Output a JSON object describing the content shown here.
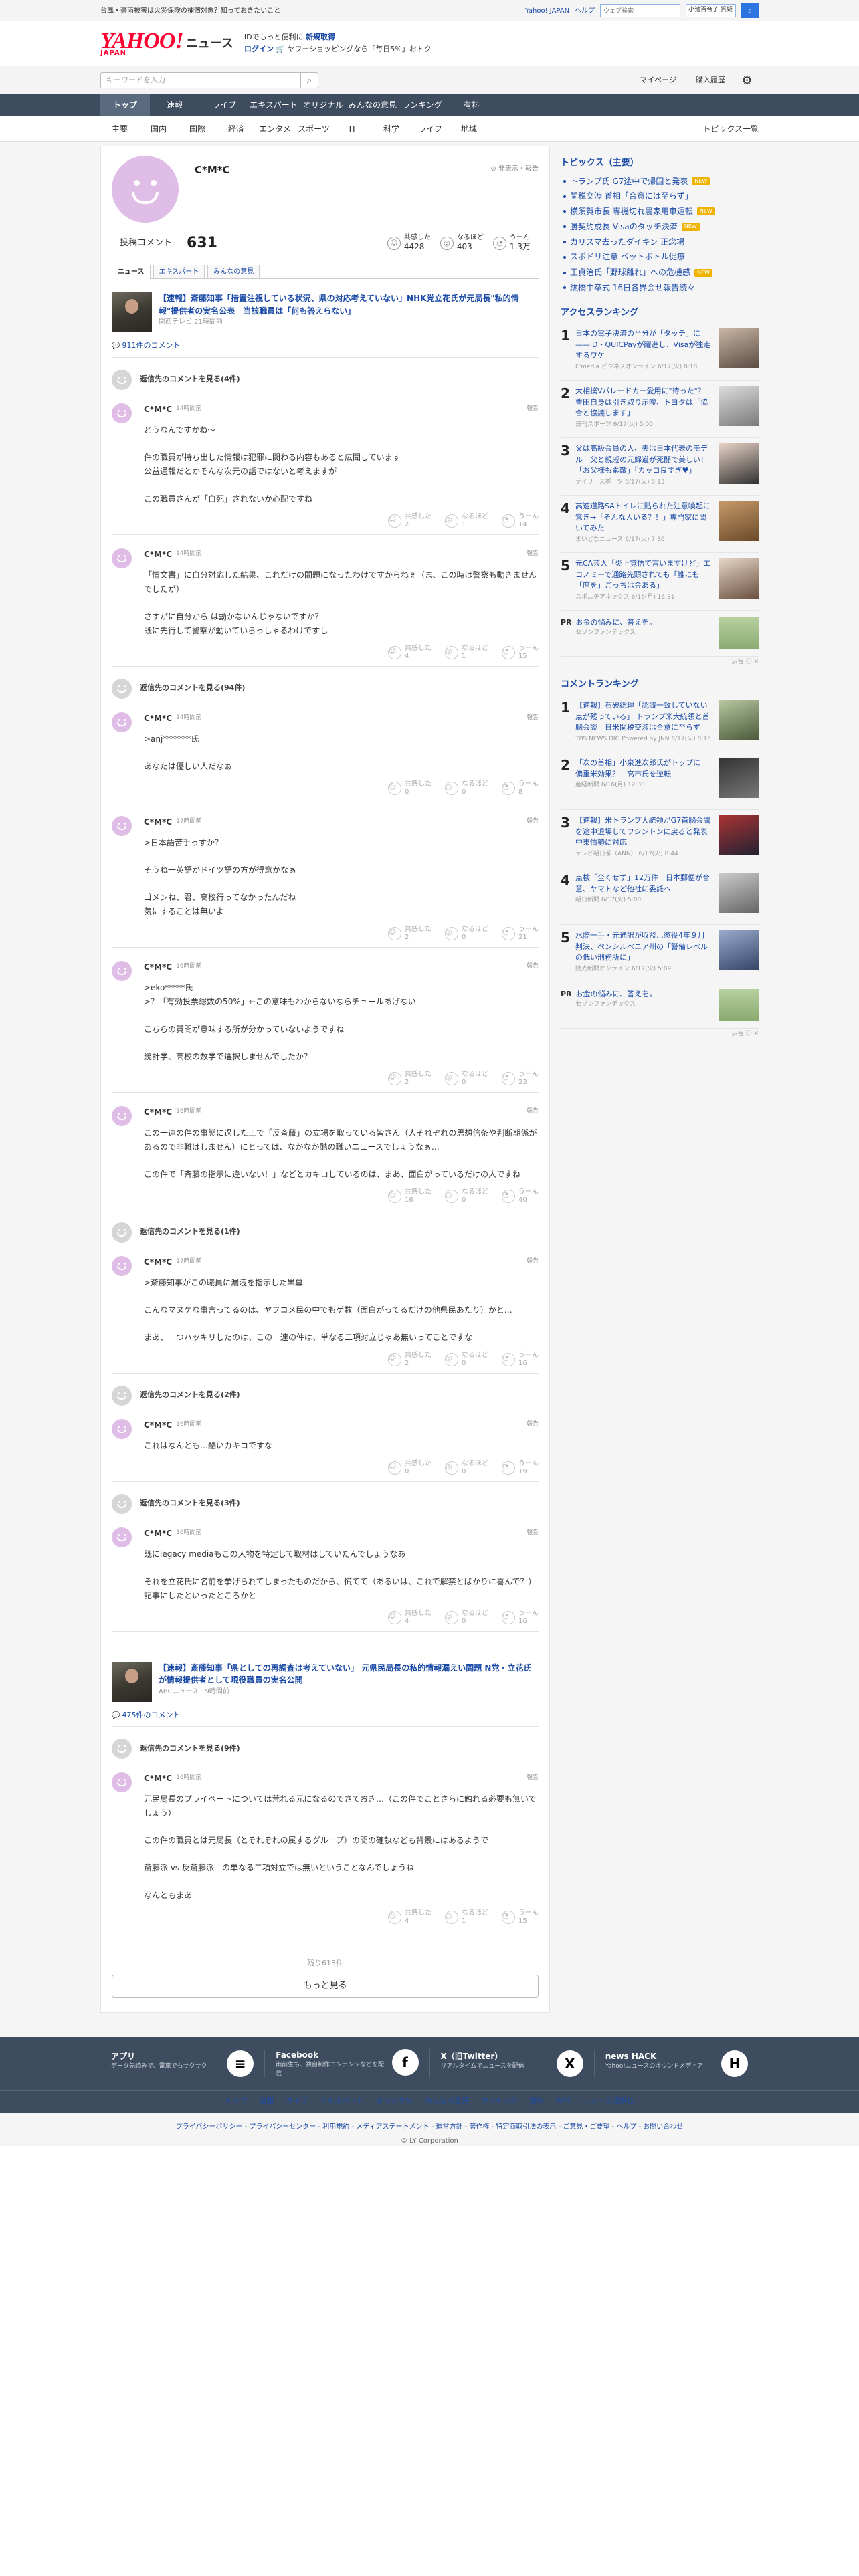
{
  "promo": {
    "text": "台風・豪雨被害は火災保険の補償対象？知っておきたいこと",
    "yahoo_japan": "Yahoo! JAPAN",
    "help": "ヘルプ",
    "web_search_placeholder": "ウェブ検索",
    "search_keyword": "小池百合子 質疑"
  },
  "header": {
    "logo": "YAHOO!",
    "logo_sub_jp": "JAPAN",
    "section": "ニュース",
    "msg1_prefix": "IDでもっと便利に",
    "msg1_link": "新規取得",
    "login": "ログイン",
    "msg2": "ヤフーショッピングなら「毎日5%」おトク"
  },
  "searchbar": {
    "placeholder": "キーワードを入力",
    "mypage": "マイページ",
    "history": "購入履歴"
  },
  "nav": [
    "トップ",
    "速報",
    "ライブ",
    "エキスパート",
    "オリジナル",
    "みんなの意見",
    "ランキング",
    "有料"
  ],
  "subnav": [
    "主要",
    "国内",
    "国際",
    "経済",
    "エンタメ",
    "スポーツ",
    "IT",
    "科学",
    "ライフ",
    "地域"
  ],
  "topics_all": "トピックス一覧",
  "profile": {
    "name": "C*M*C",
    "hide": "非表示・報告",
    "posts_label": "投稿コメント",
    "posts": "631",
    "agree_label": "共感した",
    "agree": "4428",
    "naruhodo_label": "なるほど",
    "naruhodo": "403",
    "hmm_label": "うーん",
    "hmm": "1.3万",
    "tabs": [
      "ニュース",
      "エキスパート",
      "みんなの意見"
    ]
  },
  "article1": {
    "title": "【速報】斎藤知事「措置注視している状況、県の対応考えていない」NHK党立花氏が元局長\"私的情報\"提供者の実名公表　当該職員は「何も答えらない」",
    "source": "関西テレビ 21時間前",
    "count": "911件のコメント"
  },
  "article2": {
    "title": "【速報】斎藤知事「県としての再調査は考えていない」 元県民局長の私的情報漏えい問題 N党・立花氏が情報提供者として現役職員の実名公開",
    "source": "ABCニュース 19時間前",
    "count": "475件のコメント"
  },
  "labels": {
    "report": "報告",
    "agree": "共感した",
    "naruhodo": "なるほど",
    "hmm": "うーん"
  },
  "threads": [
    {
      "reply": "返信先のコメントを見る(4件)",
      "time": "14時間前",
      "paras": [
        "どうなんですかね〜",
        "件の職員が持ち出した情報は犯罪に関わる内容もあると広聞しています\n公益通報だとかそんな次元の話ではないと考えますが",
        "この職員さんが「自死」されないか心配ですね"
      ],
      "a": "2",
      "n": "1",
      "h": "14"
    },
    {
      "reply": "",
      "time": "14時間前",
      "paras": [
        "「情文書」に自分対応した結果、これだけの問題になったわけですからねぇ（ま、この時は警察も動きませんでしたが）",
        "さすがに自分から は動かないんじゃないですか？\n既に先行して警察が動いていらっしゃるわけですし"
      ],
      "a": "4",
      "n": "1",
      "h": "15"
    },
    {
      "reply": "返信先のコメントを見る(94件)",
      "time": "14時間前",
      "paras": [
        ">anj*******氏",
        "あなたは優しい人だなぁ"
      ],
      "a": "0",
      "n": "0",
      "h": "8"
    },
    {
      "reply": "",
      "time": "17時間前",
      "paras": [
        ">日本語苦手っすか？",
        "そうね一英語かドイツ語の方が得意かなぁ",
        "ゴメンね、君、高校行ってなかったんだね\n気にすることは無いよ"
      ],
      "a": "2",
      "n": "0",
      "h": "21"
    },
    {
      "reply": "",
      "time": "16時間前",
      "paras": [
        ">eko*****氏\n>？「有効投票総数の50%」←この意味もわからないならチュールあげない",
        "こちらの質問が意味する所が分かっていないようですね",
        "統計学、高校の数学で選択しませんでしたか？"
      ],
      "a": "2",
      "n": "0",
      "h": "23"
    },
    {
      "reply": "",
      "time": "16時間前",
      "paras": [
        "この一連の件の事態に過した上で「反斉藤」の立場を取っている皆さん（人それぞれの思想信条や判断期係があるので非難はしません）にとっては、なかなか酷の職いニュースでしょうなぁ…",
        "この件で「斉藤の指示に違いない！」などとカキコしているのは、まあ、面白がっているだけの人ですね"
      ],
      "a": "16",
      "n": "0",
      "h": "40"
    },
    {
      "reply": "返信先のコメントを見る(1件)",
      "time": "17時間前",
      "paras": [
        ">斎藤知事がこの職員に漏洩を指示した黒幕",
        "こんなマヌケな事言ってるのは、ヤフコメ民の中でもゲ数（面白がってるだけの他県民あたり）かと…",
        "まあ、一つハッキリしたのは、この一連の件は、単なる二項対立じゃあ無いってことですな"
      ],
      "a": "2",
      "n": "0",
      "h": "16"
    },
    {
      "reply": "返信先のコメントを見る(2件)",
      "time": "16時間前",
      "paras": [
        "これはなんとも…酷いカキコですな"
      ],
      "a": "0",
      "n": "0",
      "h": "19"
    },
    {
      "reply": "返信先のコメントを見る(3件)",
      "time": "16時間前",
      "paras": [
        "既にlegacy mediaもこの人物を特定して取材はしていたんでしょうなあ",
        "それを立花氏に名前を挙げられてしまったものだから、慌てて（あるいは、これで解禁とばかりに喜んで？）記事にしたといったところかと"
      ],
      "a": "4",
      "n": "0",
      "h": "16"
    }
  ],
  "thread2": {
    "reply": "返信先のコメントを見る(9件)",
    "time": "16時間前",
    "paras": [
      "元民局長のプライベートについては荒れる元になるのでさておき…（この件でことさらに触れる必要も無いでしょう）",
      "この件の職員とは元局長（とそれぞれの属するグループ）の間の確執なども背景にはあるようで",
      "斎藤派 vs 反斎藤派　の単なる二項対立では無いということなんでしょうね",
      "なんともまあ"
    ],
    "a": "4",
    "n": "1",
    "h": "15"
  },
  "remain": "残り613件",
  "more": "もっと見る",
  "side": {
    "topics_head": "トピックス（主要）",
    "topics": [
      {
        "t": "トランプ氏 G7途中で帰国と発表",
        "new": "NEW"
      },
      {
        "t": "関税交渉 首相「合意には至らず」",
        "new": ""
      },
      {
        "t": "横須賀市長 専機切れ農家用車運転",
        "new": "NEW"
      },
      {
        "t": "勝契約成長 Visaのタッチ決済",
        "new": "NEW"
      },
      {
        "t": "カリスマ去ったダイキン 正念場",
        "new": ""
      },
      {
        "t": "スポドリ注意 ペットボトル促療",
        "new": ""
      },
      {
        "t": "王貞治氏「野球離れ」への危機感",
        "new": "NEW"
      },
      {
        "t": "紘橋中卒式 16日各界会せ報告続々",
        "new": ""
      }
    ],
    "access_head": "アクセスランキング",
    "access": [
      {
        "t": "日本の電子決済の半分が「タッチ」に——iD・QUICPayが躍進し、Visaが独走するワケ",
        "m": "ITmedia ビジネスオンライン 6/17(火) 8:18"
      },
      {
        "t": "大相撲Vパレードカー愛用に\"待った\"？曹田自身は引き取り示唆、トヨタは「協合と協議します」",
        "m": "日刊スポーツ 6/17(火) 5:00"
      },
      {
        "t": "父は高級会員の人、夫は日本代表のモデル　父と親戚の元歸道が死闘で美しい！「お父様も素敵」「カッコ良すぎ♥」",
        "m": "デイリースポーツ 6/17(火) 6:13"
      },
      {
        "t": "高速道路SAトイレに貼られた注意喚起に驚き→「そんな人いる？！」専門家に聞いてみた",
        "m": "まいどなニュース 6/17(火) 7:30"
      },
      {
        "t": "元CA芸人「炎上覚悟で言いますけど」エコノミーで通路先頭されても「誰にも「席を」ごっちは金ある」",
        "m": "スポニチアネックス 6/16(月) 16:31"
      }
    ],
    "ad1": {
      "title": "お金の悩みに、答えを。",
      "sub": "セゾンファンデックス"
    },
    "comment_head": "コメントランキング",
    "comment": [
      {
        "t": "【速報】石破総理「認識一致していない点が残っている」 トランプ米大統領と首脳会談　日米関税交渉は合意に至らず",
        "m": "TBS NEWS DIG Powered by JNN 6/17(火) 8:15"
      },
      {
        "t": "「次の首相」小泉進次郎氏がトップに　偏重米効果？　高市氏を逆転",
        "m": "産経新聞 6/16(月) 12:30"
      },
      {
        "t": "【速報】米トランプ大統領がG7首脳会議を途中退場してワシントンに戻ると発表　中東情勢に対応",
        "m": "テレビ朝日系（ANN） 6/17(火) 8:44"
      },
      {
        "t": "点検「全くせず」12万件　日本郵便が合意、ヤマトなど他社に委託へ",
        "m": "朝日新聞 6/17(火) 5:00"
      },
      {
        "t": "水際一手・元通訳が収監…懲役4年９月判決、ペンシルベニア州の「警備レベルの低い刑務所に」",
        "m": "読売新聞オンライン 6/17(火) 5:09"
      }
    ],
    "ad2": {
      "title": "お金の悩みに、答えを。",
      "sub": "セゾンファンデックス"
    },
    "ad_label": "広告"
  },
  "footer": {
    "apps": [
      {
        "title": "アプリ",
        "sub": "データ先読みで、電車でもサクサク",
        "icon": "≡"
      },
      {
        "title": "Facebook",
        "sub": "雨前生も、独自制作コンテンツなどを配信",
        "icon": "f"
      },
      {
        "title": "X（旧Twitter）",
        "sub": "リアルタイムでニュースを配信",
        "icon": "X"
      },
      {
        "title": "news HACK",
        "sub": "Yahoo!ニュースのオウンドメディア",
        "icon": "H"
      }
    ],
    "nav": [
      "トップ",
      "速報",
      "ライブ",
      "エキスパート",
      "オリジナル",
      "みんなの意見",
      "ランキング",
      "有料",
      "RSS",
      "ニュース提供社"
    ],
    "links": "プライバシーポリシー - プライバシーセンター - 利用規約 - メディアステートメント - 運営方針 - 著作権 - 特定商取引法の表示 - ご意見・ご要望 - ヘルプ - お問い合わせ",
    "copy": "© LY Corporation"
  },
  "colors": {
    "nav": "#3d4c5e",
    "link": "#1a4aa6",
    "avatar": "#e0bde6",
    "brand": "#ff0033"
  }
}
